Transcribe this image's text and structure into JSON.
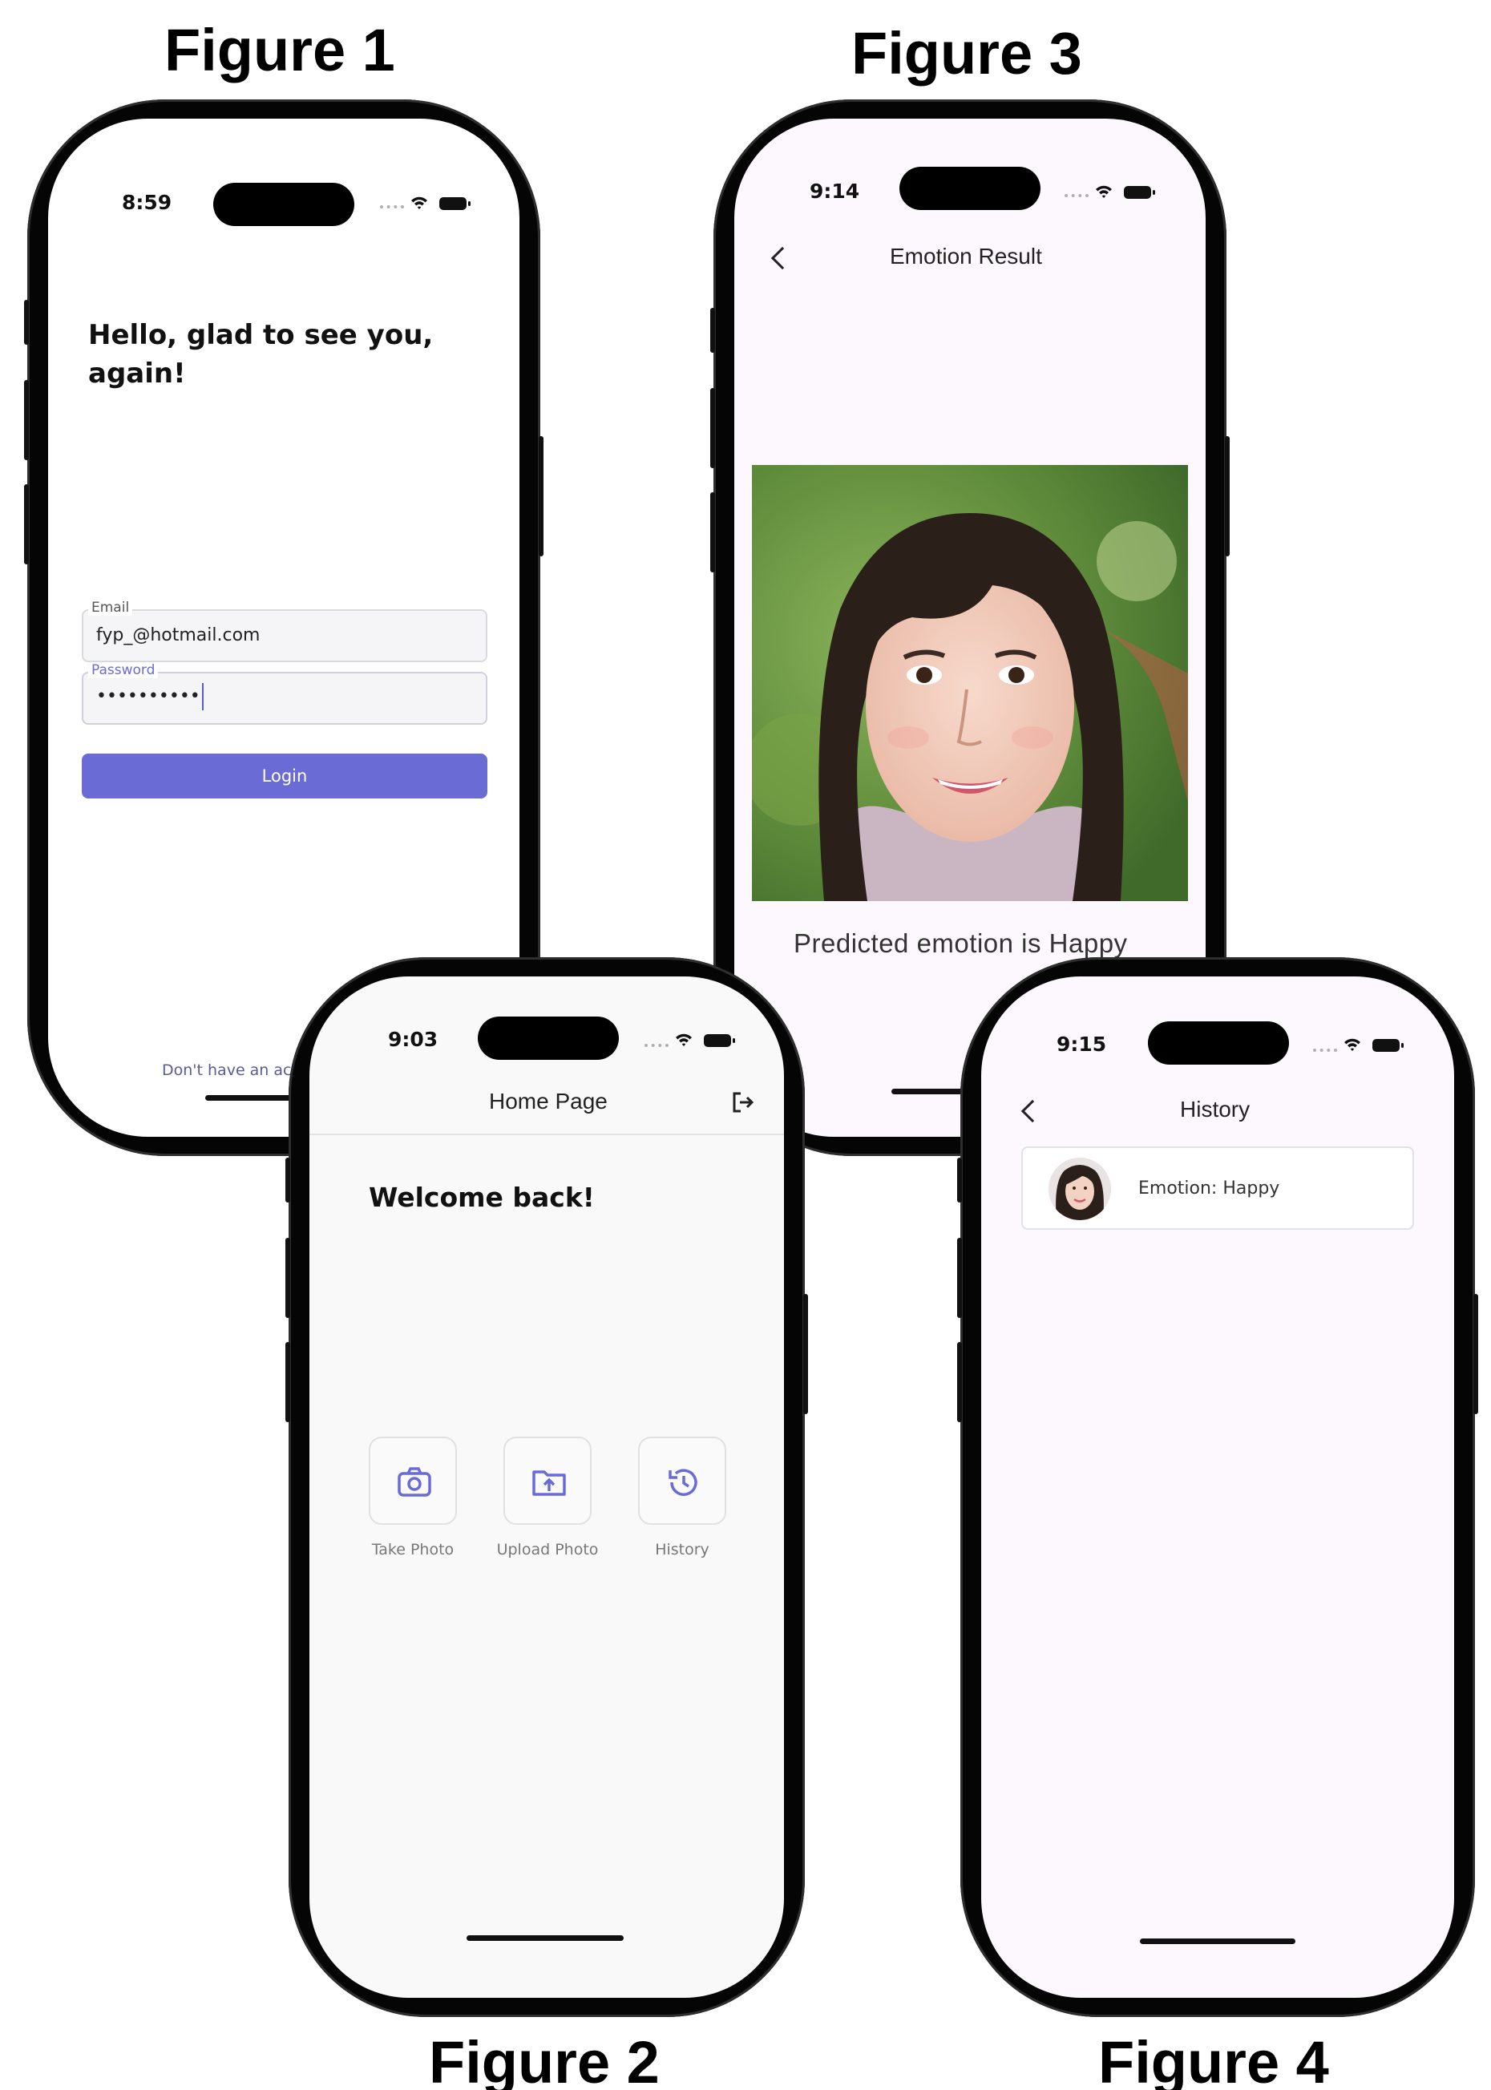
{
  "figures": {
    "fig1": "Figure 1",
    "fig2": "Figure 2",
    "fig3": "Figure 3",
    "fig4": "Figure 4"
  },
  "login_screen": {
    "time": "8:59",
    "greeting_line1": "Hello, glad to see you,",
    "greeting_line2": "again!",
    "email_label": "Email",
    "email_value": "fyp_@hotmail.com",
    "password_label": "Password",
    "password_value": "••••••••••",
    "login_label": "Login",
    "signup_text": "Don't have an ac"
  },
  "home_screen": {
    "time": "9:03",
    "title": "Home Page",
    "logout_icon": "logout-icon",
    "welcome": "Welcome back!",
    "actions": [
      {
        "label": "Take Photo",
        "icon": "camera-icon"
      },
      {
        "label": "Upload Photo",
        "icon": "folder-upload-icon"
      },
      {
        "label": "History",
        "icon": "history-icon"
      }
    ]
  },
  "result_screen": {
    "time": "9:14",
    "title": "Emotion Result",
    "predicted": "Predicted emotion is Happy"
  },
  "history_screen": {
    "time": "9:15",
    "title": "History",
    "items": [
      {
        "text": "Emotion: Happy"
      }
    ]
  },
  "colors": {
    "accent": "#6b6bd6",
    "screen_bg_tinted": "#fdf8fd",
    "home_bg": "#f9f9fa"
  }
}
